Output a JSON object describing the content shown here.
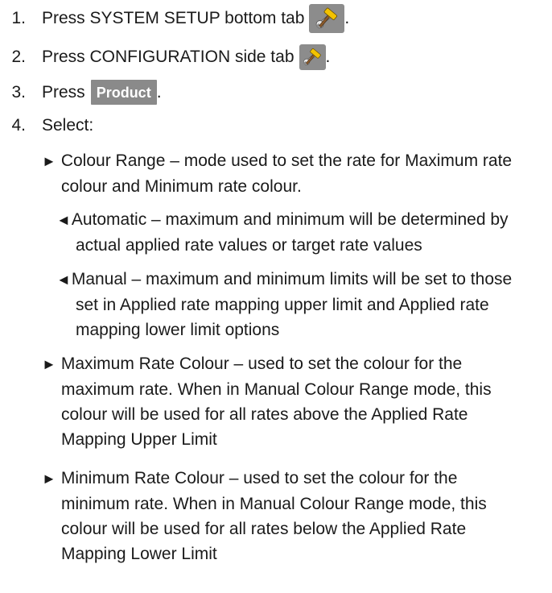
{
  "steps": [
    {
      "num": "1.",
      "text": "Press SYSTEM SETUP bottom tab",
      "icon": "tools-icon",
      "suffix": "."
    },
    {
      "num": "2.",
      "text": "Press CONFIGURATION side tab",
      "icon": "tools-icon",
      "suffix": "."
    },
    {
      "num": "3.",
      "text": "Press",
      "button": "Product",
      "suffix": "."
    },
    {
      "num": "4.",
      "text": "Select:"
    }
  ],
  "options": [
    {
      "bullet": "►",
      "lines": [
        "Colour Range – mode used to set the rate for Maximum rate",
        "colour and Minimum rate colour."
      ],
      "sub": [
        {
          "bullet": "◄",
          "lines": [
            "Automatic – maximum and minimum will be determined by",
            "actual applied rate values or target rate values"
          ]
        },
        {
          "bullet": "◄",
          "lines": [
            "Manual – maximum and minimum limits will be set to those",
            "set in Applied rate mapping upper limit and Applied rate",
            "mapping lower limit options"
          ]
        }
      ]
    },
    {
      "bullet": "►",
      "lines": [
        "Maximum Rate Colour – used to set the colour for the",
        "maximum rate. When in Manual Colour Range mode, this",
        "colour will be used for all rates above the Applied Rate",
        "Mapping Upper Limit"
      ]
    },
    {
      "bullet": "►",
      "lines": [
        "Minimum Rate Colour – used to set the colour for the",
        "minimum rate. When in Manual Colour Range mode, this",
        "colour will be used for all rates below the Applied Rate",
        "Mapping Lower Limit"
      ]
    }
  ],
  "colors": {
    "icon_bg": "#8c8c8c",
    "button_bg": "#8a8a8a",
    "hammer_head": "#e6b800",
    "wrench": "#dcdcdc"
  }
}
